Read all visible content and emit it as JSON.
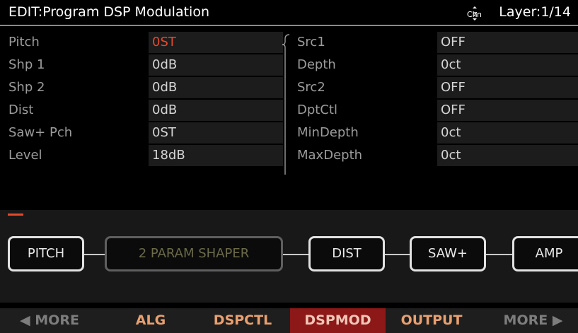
{
  "header": {
    "title": "EDIT:Program DSP Modulation",
    "chzn_icon": "ChZn",
    "layer": "Layer:1/14"
  },
  "left_params": [
    {
      "label": "Pitch",
      "value": "0ST",
      "selected": true
    },
    {
      "label": "Shp 1",
      "value": "0dB"
    },
    {
      "label": "Shp 2",
      "value": "0dB"
    },
    {
      "label": "Dist",
      "value": "0dB"
    },
    {
      "label": "Saw+ Pch",
      "value": "0ST"
    },
    {
      "label": "Level",
      "value": "18dB"
    }
  ],
  "right_params": [
    {
      "label": "Src1",
      "value": "OFF"
    },
    {
      "label": "Depth",
      "value": "0ct"
    },
    {
      "label": "Src2",
      "value": "OFF"
    },
    {
      "label": "DptCtl",
      "value": "OFF"
    },
    {
      "label": "MinDepth",
      "value": "0ct"
    },
    {
      "label": "MaxDepth",
      "value": "0ct"
    }
  ],
  "algorithm": {
    "blocks": [
      "PITCH",
      "2 PARAM SHAPER",
      "DIST",
      "SAW+",
      "AMP"
    ]
  },
  "softkeys": {
    "more_left": "◀ MORE",
    "alg": "ALG",
    "dspctl": "DSPCTL",
    "dspmod": "DSPMOD",
    "output": "OUTPUT",
    "more_right": "MORE ▶"
  },
  "colors": {
    "selected_value": "#e24a2c",
    "active_softkey": "#8c1818",
    "softkey_text": "#e8a070"
  }
}
